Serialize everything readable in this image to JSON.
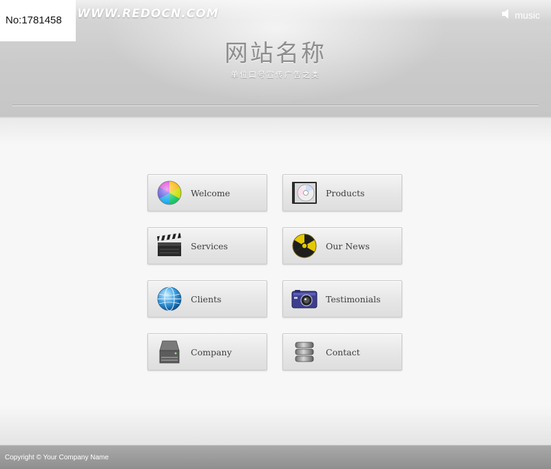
{
  "watermark": {
    "id_text": "No:1781458"
  },
  "header": {
    "site_url": "WWW.REDOCN.COM",
    "music_label": "music",
    "site_title": "网站名称",
    "slogan": "单位口号宣传广告之类"
  },
  "menu": {
    "items": [
      {
        "label": "Welcome",
        "icon": "color-wheel-icon"
      },
      {
        "label": "Products",
        "icon": "cd-case-icon"
      },
      {
        "label": "Services",
        "icon": "clapperboard-icon"
      },
      {
        "label": "Our News",
        "icon": "radiation-icon"
      },
      {
        "label": "Clients",
        "icon": "globe-icon"
      },
      {
        "label": "Testimonials",
        "icon": "camera-icon"
      },
      {
        "label": "Company",
        "icon": "hard-drive-icon"
      },
      {
        "label": "Contact",
        "icon": "database-icon"
      }
    ]
  },
  "footer": {
    "copyright": "Copyright © Your Company Name"
  },
  "colors": {
    "header_gray": "#c8c8c8",
    "button_text": "#3d3d3d",
    "footer_gray": "#999999"
  }
}
